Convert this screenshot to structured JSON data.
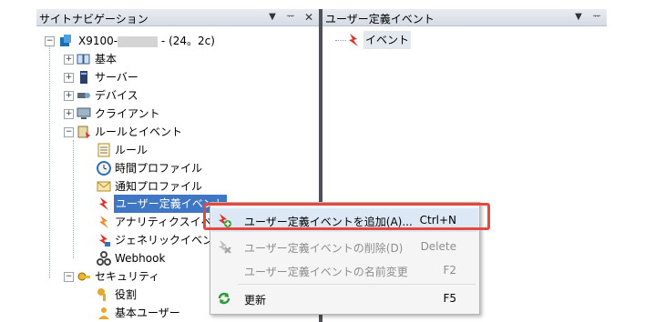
{
  "left_pane": {
    "title": "サイトナビゲーション",
    "pin_icon": "pin-icon",
    "close_icon": "close-icon",
    "tree": [
      {
        "label": "X9100-",
        "suffix": "- (24。2c)",
        "icon": "server-icon",
        "state": "expanded"
      },
      {
        "label": "基本",
        "icon": "book-icon",
        "state": "collapsed"
      },
      {
        "label": "サーバー",
        "icon": "server-rack-icon",
        "state": "collapsed"
      },
      {
        "label": "デバイス",
        "icon": "devices-icon",
        "state": "collapsed"
      },
      {
        "label": "クライアント",
        "icon": "monitor-icon",
        "state": "collapsed"
      },
      {
        "label": "ルールとイベント",
        "icon": "rules-icon",
        "state": "expanded"
      },
      {
        "label": "ルール",
        "icon": "list-icon"
      },
      {
        "label": "時間プロファイル",
        "icon": "clock-icon"
      },
      {
        "label": "通知プロファイル",
        "icon": "envelope-icon"
      },
      {
        "label": "ユーザー定義イベント",
        "icon": "user-event-icon",
        "selected": true
      },
      {
        "label": "アナリティクスイベント",
        "icon": "analytics-event-icon"
      },
      {
        "label": "ジェネリックイベント",
        "icon": "generic-event-icon"
      },
      {
        "label": "Webhook",
        "icon": "webhook-icon"
      },
      {
        "label": "セキュリティ",
        "icon": "security-icon",
        "state": "expanded"
      },
      {
        "label": "役割",
        "icon": "keys-icon"
      },
      {
        "label": "基本ユーザー",
        "icon": "user-icon"
      }
    ]
  },
  "right_pane": {
    "title": "ユーザー定義イベント",
    "pin_icon": "pin-icon",
    "items": [
      {
        "label": "イベント",
        "icon": "user-event-icon"
      }
    ]
  },
  "context_menu": {
    "items": [
      {
        "label": "ユーザー定義イベントを追加(A)...",
        "shortcut": "Ctrl+N",
        "icon": "add-event-icon",
        "enabled": true,
        "highlighted": true
      },
      {
        "label": "ユーザー定義イベントの削除(D)",
        "shortcut": "Delete",
        "icon": "delete-event-icon",
        "enabled": false
      },
      {
        "label": "ユーザー定義イベントの名前変更",
        "shortcut": "F2",
        "icon": "",
        "enabled": false
      },
      {
        "label": "更新",
        "shortcut": "F5",
        "icon": "refresh-icon",
        "enabled": true
      }
    ]
  },
  "colors": {
    "callout": "#e8473d",
    "selection": "#3f77c5"
  }
}
